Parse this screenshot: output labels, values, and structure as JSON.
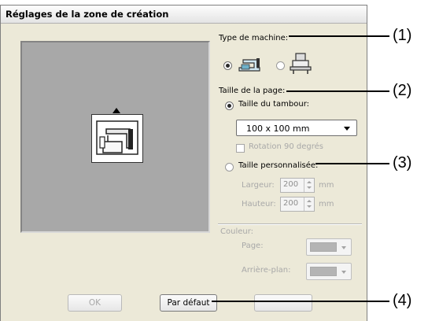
{
  "dialog": {
    "title": "Réglages de la zone de création"
  },
  "machine": {
    "section_label": "Type de machine:",
    "icon_single": "single-needle-sewing-machine-icon",
    "icon_multi": "multi-needle-embroidery-machine-icon"
  },
  "page_size": {
    "section_label": "Taille de la page:",
    "hoop_radio_label": "Taille du tambour:",
    "hoop_selected": "100 x 100 mm",
    "rotate_label": "Rotation 90 degrés",
    "custom_radio_label": "Taille personnalisée:",
    "width_label": "Largeur:",
    "width_value": "200",
    "height_label": "Hauteur:",
    "height_value": "200",
    "unit": "mm"
  },
  "color": {
    "section_label": "Couleur:",
    "page_label": "Page:",
    "background_label": "Arrière-plan:"
  },
  "buttons": {
    "ok": "OK",
    "default": "Par défaut"
  },
  "callouts": [
    "(1)",
    "(2)",
    "(3)",
    "(4)"
  ],
  "preview": {
    "icon": "sewing-machine-on-hoop-icon"
  }
}
